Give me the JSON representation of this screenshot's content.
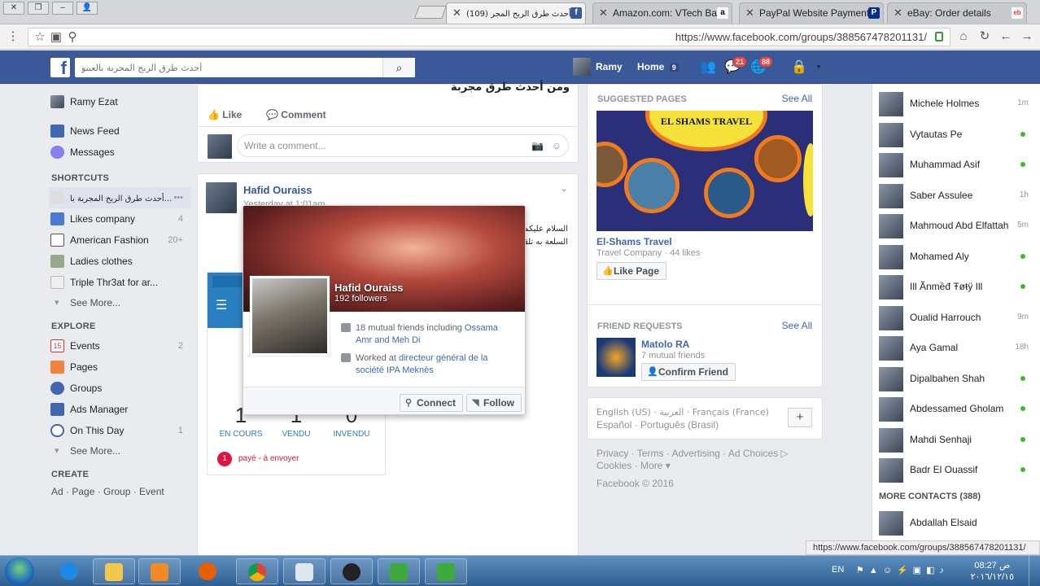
{
  "browser": {
    "tabs": [
      {
        "label": "أحدث طرق الربح المجر (109)",
        "active": true
      },
      {
        "label": "Amazon.com: VTech Bab",
        "active": false
      },
      {
        "label": "PayPal Website Payment",
        "active": false
      },
      {
        "label": "eBay: Order details",
        "active": false
      }
    ],
    "url": "https://www.facebook.com/groups/388567478201131/"
  },
  "fb": {
    "search_placeholder": "أحدث طرق الربح المجربة بالعبنو",
    "user_name": "Ramy",
    "home_label": "Home",
    "home_count": "9",
    "friend_requests_count": "21",
    "notifications_count": "88"
  },
  "leftnav": {
    "profile": "Ramy Ezat",
    "items_top": [
      {
        "label": "News Feed",
        "count": ""
      },
      {
        "label": "Messages",
        "count": ""
      }
    ],
    "shortcuts_heading": "SHORTCUTS",
    "shortcuts": [
      {
        "label": "أحدث طرق الربح المجربة با...",
        "count": "•••"
      },
      {
        "label": "Likes company",
        "count": "4"
      },
      {
        "label": "American Fashion",
        "count": "20+"
      },
      {
        "label": "Ladies clothes",
        "count": ""
      },
      {
        "label": "Triple Thr3at for ar...",
        "count": ""
      }
    ],
    "see_more": "See More...",
    "explore_heading": "EXPLORE",
    "explore": [
      {
        "label": "Events",
        "count": "2"
      },
      {
        "label": "Pages",
        "count": ""
      },
      {
        "label": "Groups",
        "count": ""
      },
      {
        "label": "Ads Manager",
        "count": ""
      },
      {
        "label": "On This Day",
        "count": "1"
      }
    ],
    "create_heading": "CREATE",
    "create_links": "Ad · Page · Group · Event"
  },
  "feed": {
    "post1_text": "ومن أحدث طرق مجربة",
    "like": "Like",
    "comment": "Comment",
    "comment_placeholder": "Write a comment...",
    "post2_author": "Hafid Ouraiss",
    "post2_time": "Yesterday at 1:01am",
    "post2_text": "السلام عليكم إذا قمت بإرسال السلعة به تلقيا المرجو توصيل",
    "shop": {
      "stats": [
        {
          "n": "1",
          "label": "EN COURS"
        },
        {
          "n": "1",
          "label": "VENDU"
        },
        {
          "n": "0",
          "label": "INVENDU"
        }
      ],
      "pay_num": "1",
      "pay_text": "payé - à envoyer"
    }
  },
  "hovercard": {
    "name": "Hafid Ouraiss",
    "followers": "192 followers",
    "mutual_prefix": "18 mutual friends including ",
    "mutual_link": "Ossama Amr and Meh Di",
    "work_prefix": "Worked at ",
    "work_link": "directeur général de la société IPA Meknès",
    "connect": "Connect",
    "follow": "Follow"
  },
  "right": {
    "suggested_heading": "SUGGESTED PAGES",
    "see_all": "See All",
    "page_banner": "EL SHAMS TRAVEL",
    "page_name": "El-Shams Travel",
    "page_meta": "Travel Company · 44 likes",
    "like_page": "Like Page",
    "requests_heading": "FRIEND REQUESTS",
    "request_name": "Matolo RA",
    "request_meta": "7 mutual friends",
    "confirm": "Confirm Friend",
    "languages_line1": "English (US) · العربية · Français (France)",
    "languages_line2": "Español · Português (Brasil)",
    "add_lang": "+",
    "footer_line1": "Privacy · Terms · Advertising · Ad Choices ▷",
    "footer_line2": "Cookies · More ▾",
    "copyright": "Facebook © 2016"
  },
  "chat": {
    "contacts": [
      {
        "name": "Michele Holmes",
        "status": "1m"
      },
      {
        "name": "Vytautas Pe",
        "status": "online"
      },
      {
        "name": "Muhammad Asif",
        "status": "online"
      },
      {
        "name": "Saber Assulee",
        "status": "1h"
      },
      {
        "name": "Mahmoud Abd Elfattah",
        "status": "5m"
      },
      {
        "name": "Mohamed Aly",
        "status": "online"
      },
      {
        "name": "Ill Ãnmềđ Ŧøŧÿ Ill",
        "status": "online"
      },
      {
        "name": "Oualid Harrouch",
        "status": "9m"
      },
      {
        "name": "Aya Gamal",
        "status": "18h"
      },
      {
        "name": "Dipalbahen Shah",
        "status": "online"
      },
      {
        "name": "Abdessamed Gholam",
        "status": "online"
      },
      {
        "name": "Mahdi Senhaji",
        "status": "online"
      },
      {
        "name": "Badr El Ouassif",
        "status": "online"
      }
    ],
    "more_heading": "MORE CONTACTS (388)",
    "more_contact": "Abdallah Elsaid"
  },
  "status_url": "https://www.facebook.com/groups/388567478201131/",
  "taskbar": {
    "lang": "EN",
    "time": "08:27 ص",
    "date": "٢٠١٦/١٢/١٥"
  }
}
